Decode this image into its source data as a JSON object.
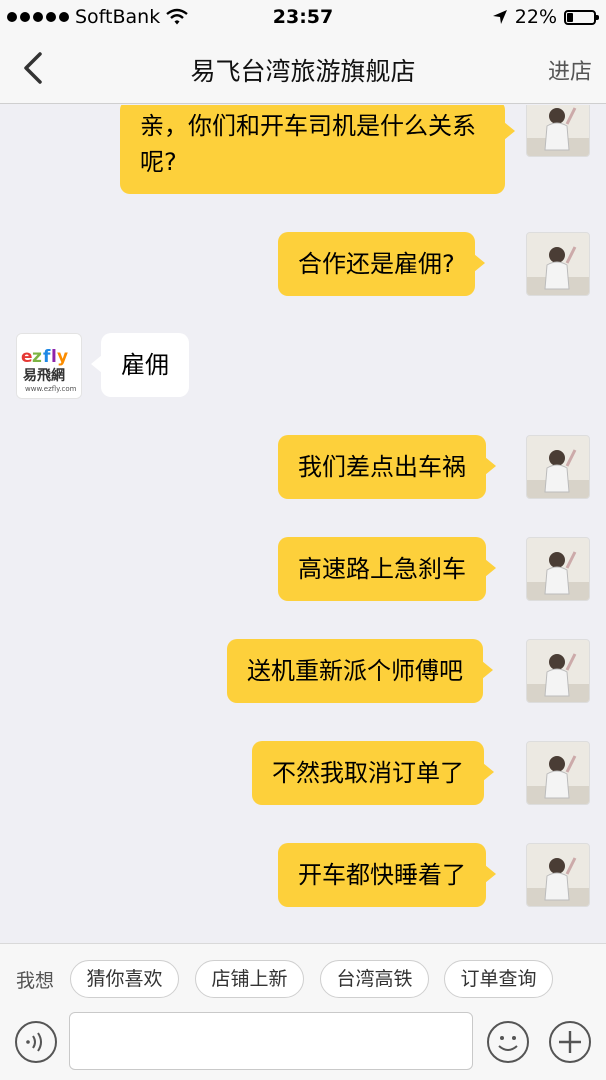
{
  "status": {
    "carrier": "SoftBank",
    "time": "23:57",
    "battery_pct": "22%",
    "battery_level": 0.22
  },
  "nav": {
    "title": "易飞台湾旅游旗舰店",
    "right": "进店"
  },
  "messages": [
    {
      "from": "me",
      "text": "亲，你们和开车司机是什么关系呢?"
    },
    {
      "from": "me",
      "text": "合作还是雇佣?"
    },
    {
      "from": "shop",
      "text": "雇佣"
    },
    {
      "from": "me",
      "text": "我们差点出车祸"
    },
    {
      "from": "me",
      "text": "高速路上急刹车"
    },
    {
      "from": "me",
      "text": "送机重新派个师傅吧"
    },
    {
      "from": "me",
      "text": "不然我取消订单了"
    },
    {
      "from": "me",
      "text": "开车都快睡着了"
    }
  ],
  "shop_logo": {
    "brand": "ezfly",
    "cn": "易飛網",
    "site": "www.ezfly.com",
    "colors": [
      "#e53935",
      "#7cb342",
      "#1e88e5",
      "#8e24aa",
      "#fb8c00"
    ]
  },
  "quick": {
    "label": "我想",
    "chips": [
      "猜你喜欢",
      "店铺上新",
      "台湾高铁",
      "订单查询"
    ]
  },
  "input": {
    "placeholder": ""
  },
  "icons": {
    "back": "chevron-left-icon",
    "voice": "voice-icon",
    "emoji": "emoji-icon",
    "plus": "plus-icon"
  },
  "colors": {
    "my_bubble": "#fdd03b",
    "their_bubble": "#ffffff",
    "background": "#efeff4"
  }
}
